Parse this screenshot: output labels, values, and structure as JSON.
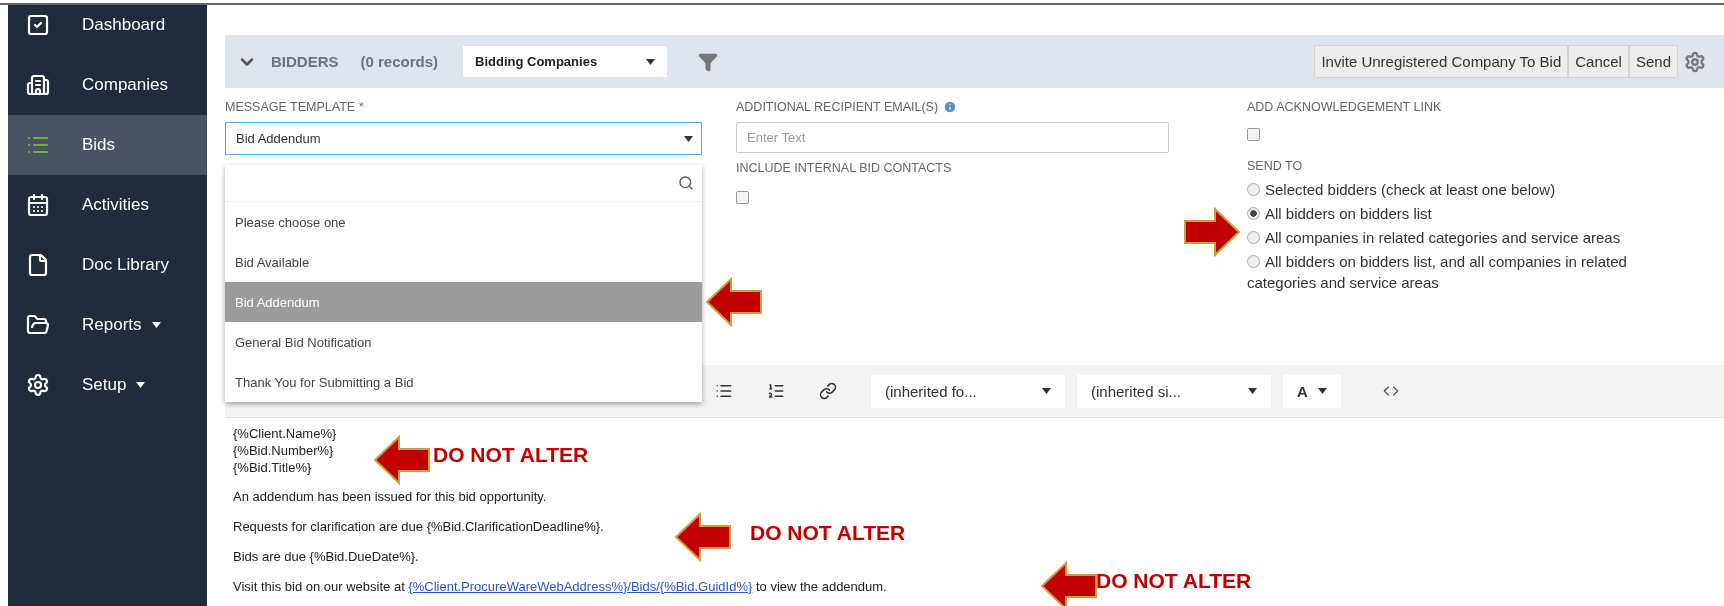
{
  "sidebar": {
    "items": [
      {
        "label": "Dashboard",
        "selected": false,
        "caret": false
      },
      {
        "label": "Companies",
        "selected": false,
        "caret": false
      },
      {
        "label": "Bids",
        "selected": true,
        "caret": false
      },
      {
        "label": "Activities",
        "selected": false,
        "caret": false
      },
      {
        "label": "Doc Library",
        "selected": false,
        "caret": false
      },
      {
        "label": "Reports",
        "selected": false,
        "caret": true
      },
      {
        "label": "Setup",
        "selected": false,
        "caret": true
      }
    ]
  },
  "header": {
    "title": "BIDDERS",
    "count": "(0 records)",
    "view_select": "Bidding Companies",
    "buttons": [
      "Invite Unregistered Company To Bid",
      "Cancel",
      "Send"
    ]
  },
  "form": {
    "message_template": {
      "label": "MESSAGE TEMPLATE",
      "required_mark": "*",
      "value": "Bid Addendum",
      "options": [
        {
          "label": "Please choose one",
          "selected": false
        },
        {
          "label": "Bid Available",
          "selected": false
        },
        {
          "label": "Bid Addendum",
          "selected": true
        },
        {
          "label": "General Bid Notification",
          "selected": false
        },
        {
          "label": "Thank You for Submitting a Bid",
          "selected": false
        }
      ]
    },
    "additional_recipients": {
      "label": "ADDITIONAL RECIPIENT EMAIL(S)",
      "placeholder": "Enter Text"
    },
    "include_internal": {
      "label": "INCLUDE INTERNAL BID CONTACTS",
      "checked": false
    },
    "add_acknowledgement": {
      "label": "ADD ACKNOWLEDGEMENT LINK",
      "checked": false
    },
    "send_to": {
      "label": "SEND TO",
      "options": [
        {
          "label": "Selected bidders (check at least one below)",
          "selected": false
        },
        {
          "label": "All bidders on bidders list",
          "selected": true
        },
        {
          "label": "All companies in related categories and service areas",
          "selected": false
        },
        {
          "label": "All bidders on bidders list, and all companies in related categories and service areas",
          "selected": false
        }
      ]
    }
  },
  "editor": {
    "toolbar_selects": [
      "(inherited fo...",
      "(inherited si...",
      "A"
    ],
    "header_lines": [
      "{%Client.Name%}",
      "{%Bid.Number%}",
      "{%Bid.Title%}"
    ],
    "paragraphs": [
      {
        "text": "An addendum has been issued for this bid opportunity."
      },
      {
        "text": "Requests for clarification are due {%Bid.ClarificationDeadline%}."
      },
      {
        "text": "Bids are due {%Bid.DueDate%}."
      },
      {
        "text": "Visit this bid on our website at ",
        "link": "{%Client.ProcureWareWebAddress%}/Bids/{%Bid.GuidId%}",
        "after": " to view the addendum."
      }
    ]
  },
  "annotations": [
    {
      "points_left": true
    },
    {
      "points_left": false
    },
    {
      "points_left": true,
      "text": "DO NOT ALTER"
    },
    {
      "points_left": true,
      "text": "DO NOT ALTER"
    },
    {
      "points_left": true,
      "text": "DO NOT ALTER"
    }
  ]
}
